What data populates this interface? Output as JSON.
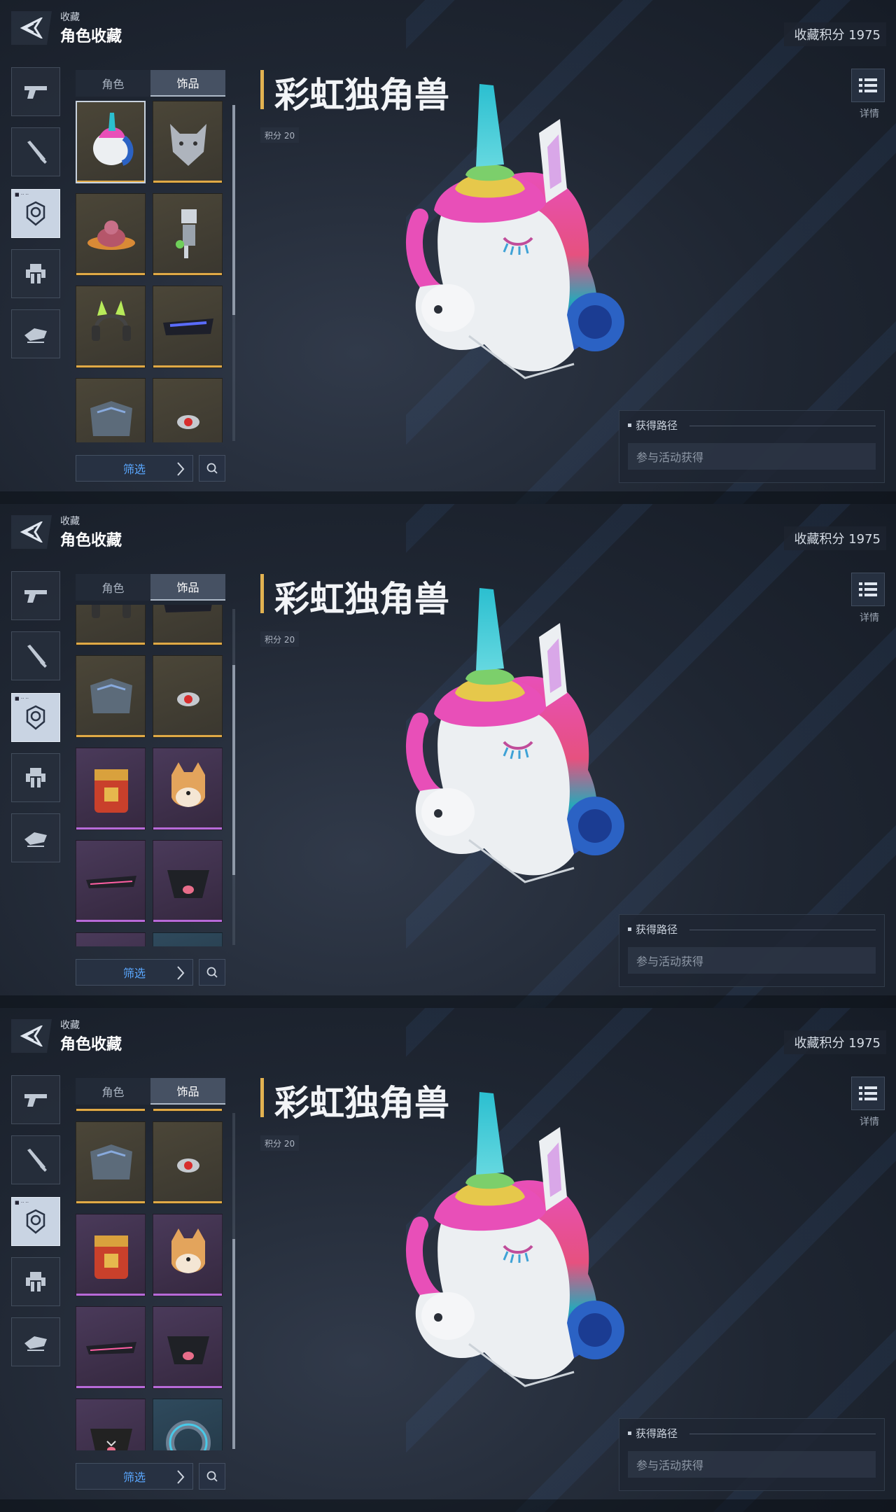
{
  "header": {
    "breadcrumb_small": "收藏",
    "title": "角色收藏",
    "score_text": "收藏积分 1975"
  },
  "nav": {
    "items": [
      "pistol-icon",
      "rifle-icon",
      "character-head-icon",
      "mech-icon",
      "vehicle-icon"
    ],
    "active_index": 2
  },
  "tabs": [
    {
      "label": "角色"
    },
    {
      "label": "饰品"
    }
  ],
  "tab_active_index": 1,
  "item": {
    "name": "彩虹独角兽",
    "points": "积分 20",
    "detail_label": "详情"
  },
  "acquire": {
    "heading": "获得路径",
    "value": "参与活动获得"
  },
  "filter": {
    "label": "筛选"
  },
  "grid_items": [
    {
      "name": "unicorn-head",
      "rarity": "gold"
    },
    {
      "name": "wolf-head",
      "rarity": "gold"
    },
    {
      "name": "ufo-dragon",
      "rarity": "gold"
    },
    {
      "name": "robot-figure",
      "rarity": "gold"
    },
    {
      "name": "cat-ear-headset",
      "rarity": "gold"
    },
    {
      "name": "visor-glasses",
      "rarity": "gold"
    },
    {
      "name": "armor-gauntlet",
      "rarity": "gold"
    },
    {
      "name": "red-eye-drone",
      "rarity": "gold"
    },
    {
      "name": "treasure-backpack",
      "rarity": "purple"
    },
    {
      "name": "shiba-head",
      "rarity": "purple"
    },
    {
      "name": "dark-visor",
      "rarity": "purple"
    },
    {
      "name": "tongue-mask",
      "rarity": "purple"
    },
    {
      "name": "kitty-mask",
      "rarity": "purple"
    },
    {
      "name": "cyber-ring",
      "rarity": "blue"
    }
  ],
  "colors": {
    "accent_gold": "#e2b251",
    "filter_blue": "#5aa7ff",
    "rarity_gold": "#e0a946",
    "rarity_purple": "#b76ad8",
    "rarity_blue": "#47b0d4"
  }
}
